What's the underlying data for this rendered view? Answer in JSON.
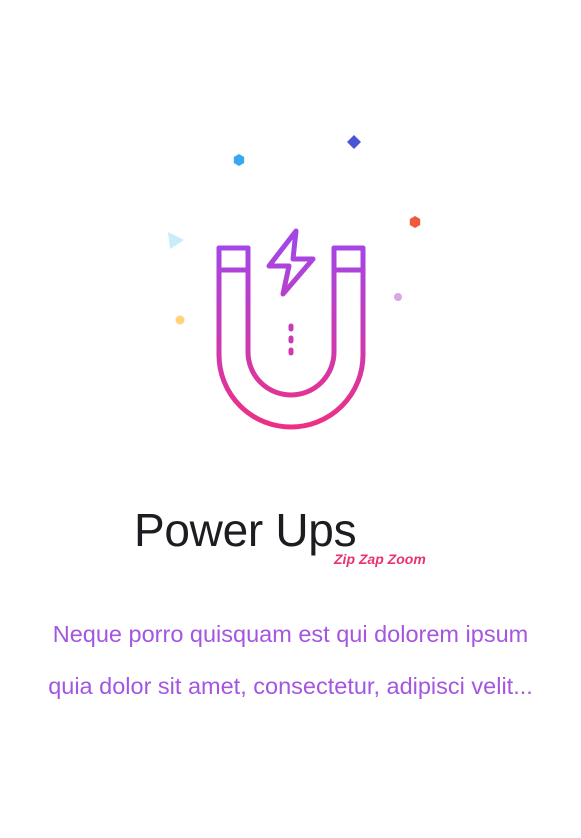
{
  "screen": {
    "title": "Power Ups",
    "tagline": "Zip Zap Zoom",
    "description": "Neque porro quisquam est qui dolorem ipsum quia dolor sit amet, consectetur, adipisci velit..."
  },
  "illustration": {
    "icon": "magnet-lightning-icon",
    "decorations": [
      "hexagon-icon",
      "diamond-icon",
      "hexagon-icon",
      "triangle-icon",
      "dot-icon",
      "dot-icon"
    ]
  },
  "colors": {
    "background": "#ffffff",
    "title": "#1c1d21",
    "tagline": "#e8336f",
    "description": "#a456e0",
    "gradient_top": "#a446e6",
    "gradient_bottom": "#ef2f82",
    "confetti_blue": "#3aa7f0",
    "confetti_indigo": "#4a55d6",
    "confetti_red": "#ef5a3c",
    "confetti_lightblue": "#c8ecf8",
    "confetti_yellow": "#ffd47a",
    "confetti_lilac": "#d7a8e4"
  }
}
